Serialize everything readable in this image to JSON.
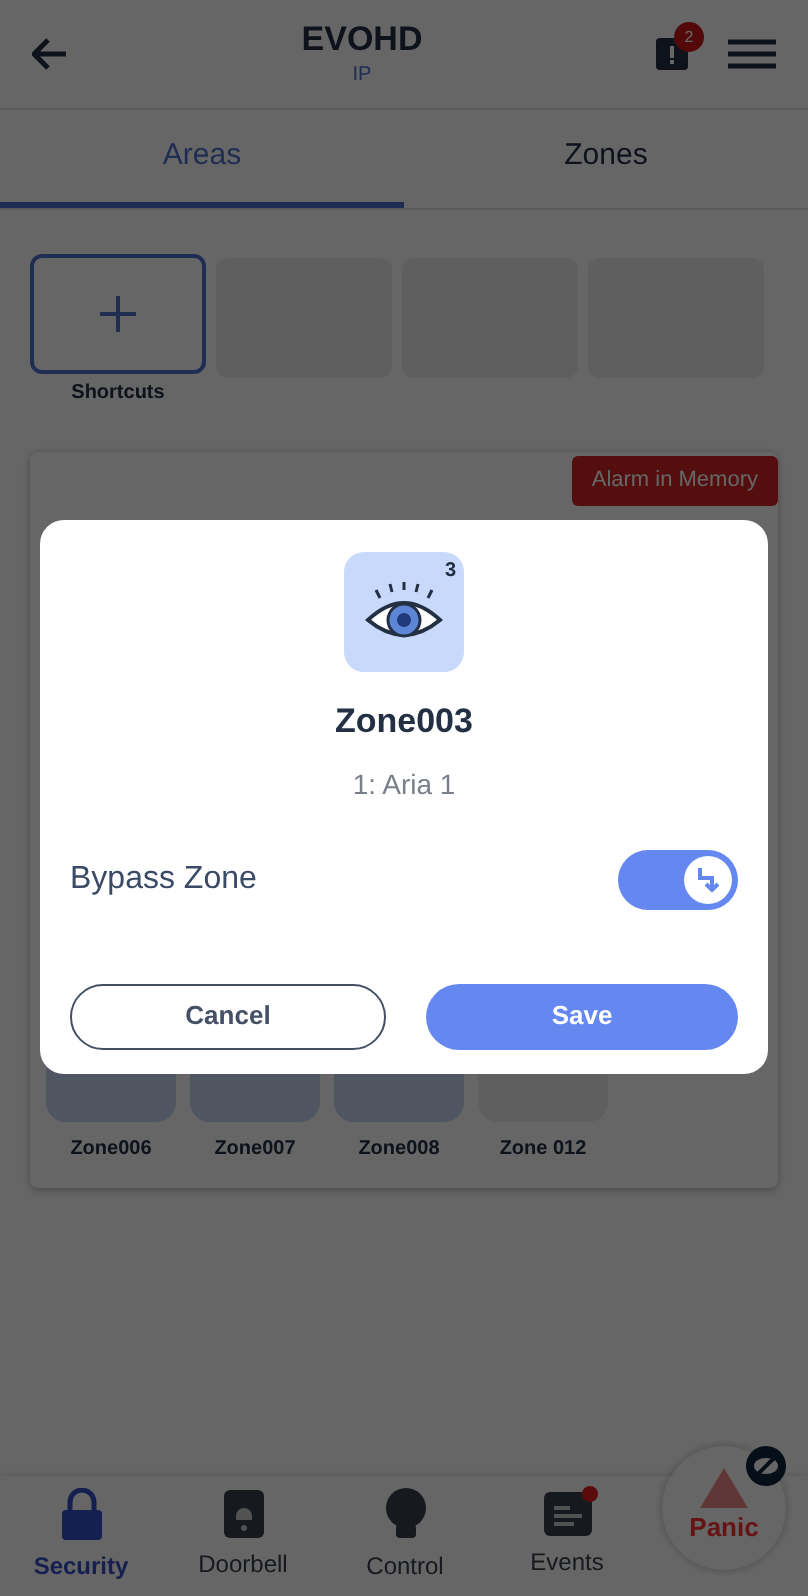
{
  "header": {
    "title": "EVOHD",
    "subtitle": "IP",
    "notification_count": "2"
  },
  "tabs": [
    {
      "label": "Areas",
      "selected": true
    },
    {
      "label": "Zones",
      "selected": false
    }
  ],
  "shortcuts": {
    "label": "Shortcuts",
    "slots": [
      {
        "kind": "empty"
      },
      {
        "kind": "empty"
      },
      {
        "kind": "empty"
      }
    ]
  },
  "area_card": {
    "badge": "Alarm in Memory",
    "zones": [
      {
        "label": "Zone006",
        "kind": "active"
      },
      {
        "label": "Zone007",
        "kind": "active"
      },
      {
        "label": "Zone008",
        "kind": "active"
      },
      {
        "label": "Zone 012",
        "kind": "inactive"
      }
    ]
  },
  "dialog": {
    "zone_number": "3",
    "zone_name": "Zone003",
    "area": "1: Aria 1",
    "bypass": {
      "label": "Bypass Zone",
      "on": true
    },
    "buttons": [
      {
        "label": "Cancel",
        "kind": "outline"
      },
      {
        "label": "Save",
        "kind": "primary"
      }
    ]
  },
  "bottom_nav": [
    {
      "label": "Security",
      "selected": true,
      "dot": false,
      "kind": "lock"
    },
    {
      "label": "Doorbell",
      "selected": false,
      "dot": false,
      "kind": "bell"
    },
    {
      "label": "Control",
      "selected": false,
      "dot": false,
      "kind": "bulb"
    },
    {
      "label": "Events",
      "selected": false,
      "dot": true,
      "kind": "list"
    }
  ],
  "panic": {
    "label": "Panic"
  }
}
